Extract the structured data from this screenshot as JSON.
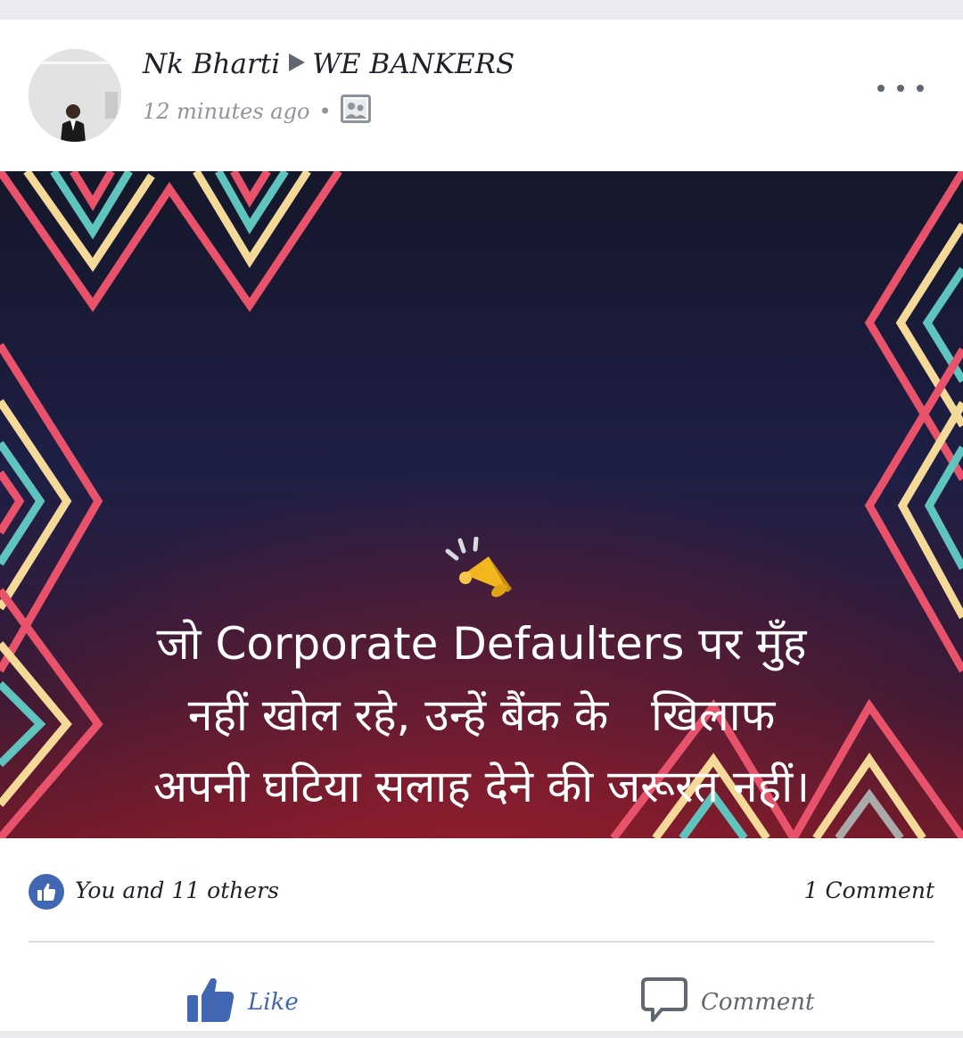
{
  "post": {
    "author": "Nk Bharti",
    "group": "WE BANKERS",
    "time": "12 minutes ago",
    "privacy_icon": "group-photo-icon",
    "more_icon": "more-dots-icon"
  },
  "image_text": {
    "lines": [
      "जो Corporate Defaulters पर मुँह",
      "नहीं खोल रहे, उन्हें बैंक के   खिलाफ",
      "अपनी घटिया सलाह देने की जरूरत नहीं।"
    ],
    "icon": "megaphone-icon"
  },
  "reactions": {
    "summary": "You and 11 others",
    "comments": "1 Comment"
  },
  "actions": {
    "like": "Like",
    "comment": "Comment"
  },
  "colors": {
    "brand_blue": "#4267b2",
    "zigzag_pink": "#e8536b",
    "zigzag_cream": "#f5d999",
    "zigzag_teal": "#5fc4bd",
    "bg_dark": "#1a1b35",
    "bg_red": "#8a1c2c"
  }
}
